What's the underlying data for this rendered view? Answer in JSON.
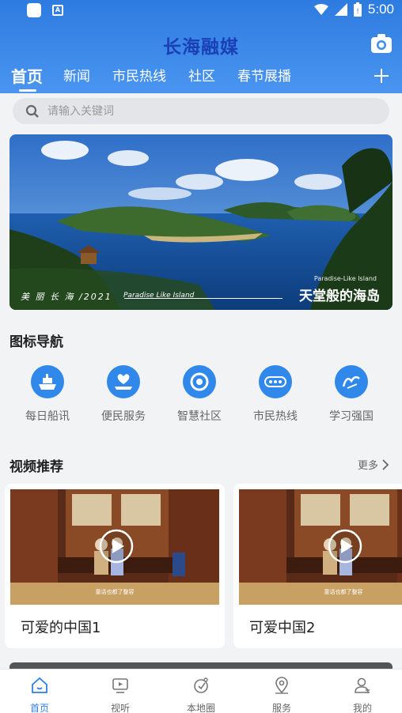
{
  "status_bar": {
    "time": "5:00",
    "left_icons": [
      "app-icon",
      "a-icon"
    ],
    "right_icons": [
      "wifi-icon",
      "signal-icon",
      "battery-icon"
    ]
  },
  "header": {
    "app_title": "长海融媒",
    "camera_icon": "camera-icon"
  },
  "tabs": [
    {
      "label": "首页",
      "active": true
    },
    {
      "label": "新闻",
      "active": false
    },
    {
      "label": "市民热线",
      "active": false
    },
    {
      "label": "社区",
      "active": false
    },
    {
      "label": "春节展播",
      "active": false
    }
  ],
  "search": {
    "placeholder": "请输入关键词"
  },
  "banner": {
    "caption_left": "美 丽 长 海 /2021",
    "caption_left_en": "Paradise Like Island",
    "caption_right_en": "Paradise-Like Island",
    "caption_right": "天堂般的海岛"
  },
  "icon_nav": {
    "title": "图标导航",
    "items": [
      {
        "label": "每日船讯",
        "icon": "ship-icon"
      },
      {
        "label": "便民服务",
        "icon": "heart-hand-icon"
      },
      {
        "label": "智慧社区",
        "icon": "community-icon"
      },
      {
        "label": "市民热线",
        "icon": "hotline-icon"
      },
      {
        "label": "学习强国",
        "icon": "study-icon"
      }
    ]
  },
  "video_section": {
    "title": "视频推荐",
    "more_label": "更多",
    "videos": [
      {
        "title": "可爱的中国1",
        "subtitle": "童话也都了整容"
      },
      {
        "title": "可爱中国2",
        "subtitle": "童话也都了整容"
      }
    ]
  },
  "bottom_nav": [
    {
      "label": "首页",
      "icon": "home-icon",
      "active": true
    },
    {
      "label": "视听",
      "icon": "tv-icon",
      "active": false
    },
    {
      "label": "本地圈",
      "icon": "local-circle-icon",
      "active": false
    },
    {
      "label": "服务",
      "icon": "location-pin-icon",
      "active": false
    },
    {
      "label": "我的",
      "icon": "user-icon",
      "active": false
    }
  ],
  "colors": {
    "primary": "#2f7fe6",
    "header_top": "#2d7be0",
    "title_text": "#1a3fb6"
  }
}
